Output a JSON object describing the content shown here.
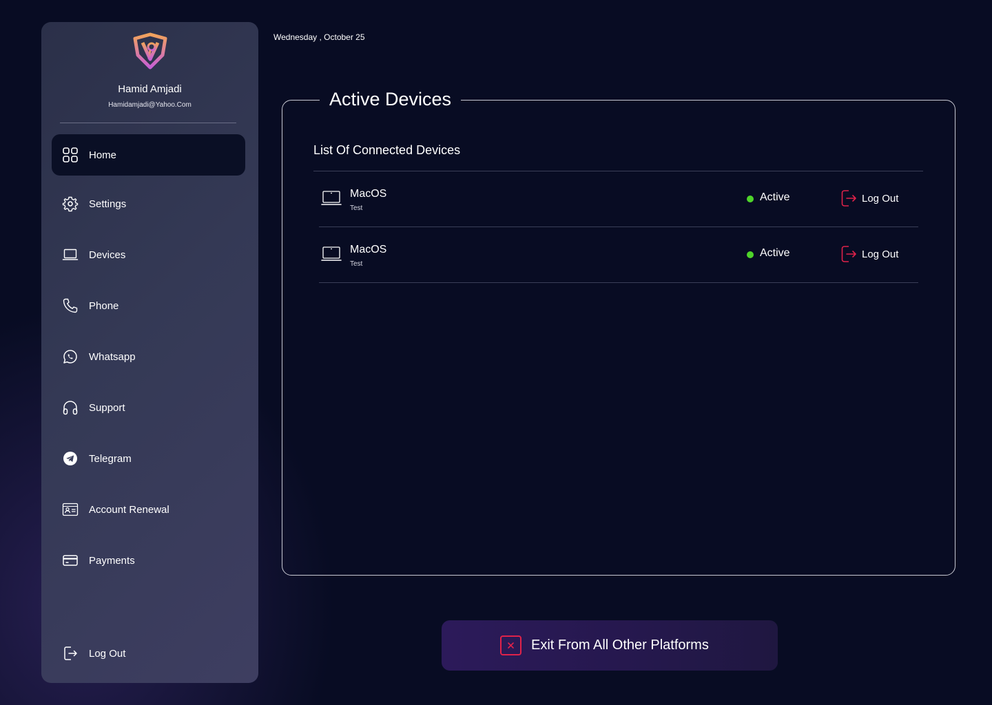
{
  "date": "Wednesday , October 25",
  "user": {
    "name": "Hamid Amjadi",
    "email": "Hamidamjadi@Yahoo.Com"
  },
  "sidebar": {
    "items": [
      {
        "label": "Home",
        "icon": "grid-icon",
        "active": true
      },
      {
        "label": "Settings",
        "icon": "gear-icon"
      },
      {
        "label": "Devices",
        "icon": "laptop-icon"
      },
      {
        "label": "Phone",
        "icon": "phone-icon"
      },
      {
        "label": "Whatsapp",
        "icon": "whatsapp-icon"
      },
      {
        "label": "Support",
        "icon": "headphones-icon"
      },
      {
        "label": "Telegram",
        "icon": "telegram-icon"
      },
      {
        "label": "Account Renewal",
        "icon": "id-card-icon"
      },
      {
        "label": "Payments",
        "icon": "credit-card-icon"
      }
    ],
    "logout_label": "Log Out"
  },
  "main": {
    "title": "Active Devices",
    "list_title": "List Of Connected Devices",
    "devices": [
      {
        "name": "MacOS",
        "sub": "Test",
        "status": "Active",
        "action": "Log Out"
      },
      {
        "name": "MacOS",
        "sub": "Test",
        "status": "Active",
        "action": "Log Out"
      }
    ],
    "exit_all_label": "Exit From All Other Platforms"
  },
  "colors": {
    "background": "#080c23",
    "active_status": "#4ed42a",
    "danger": "#e0224a",
    "logo_orange": "#f2a35c",
    "logo_pink": "#c85fd6"
  }
}
